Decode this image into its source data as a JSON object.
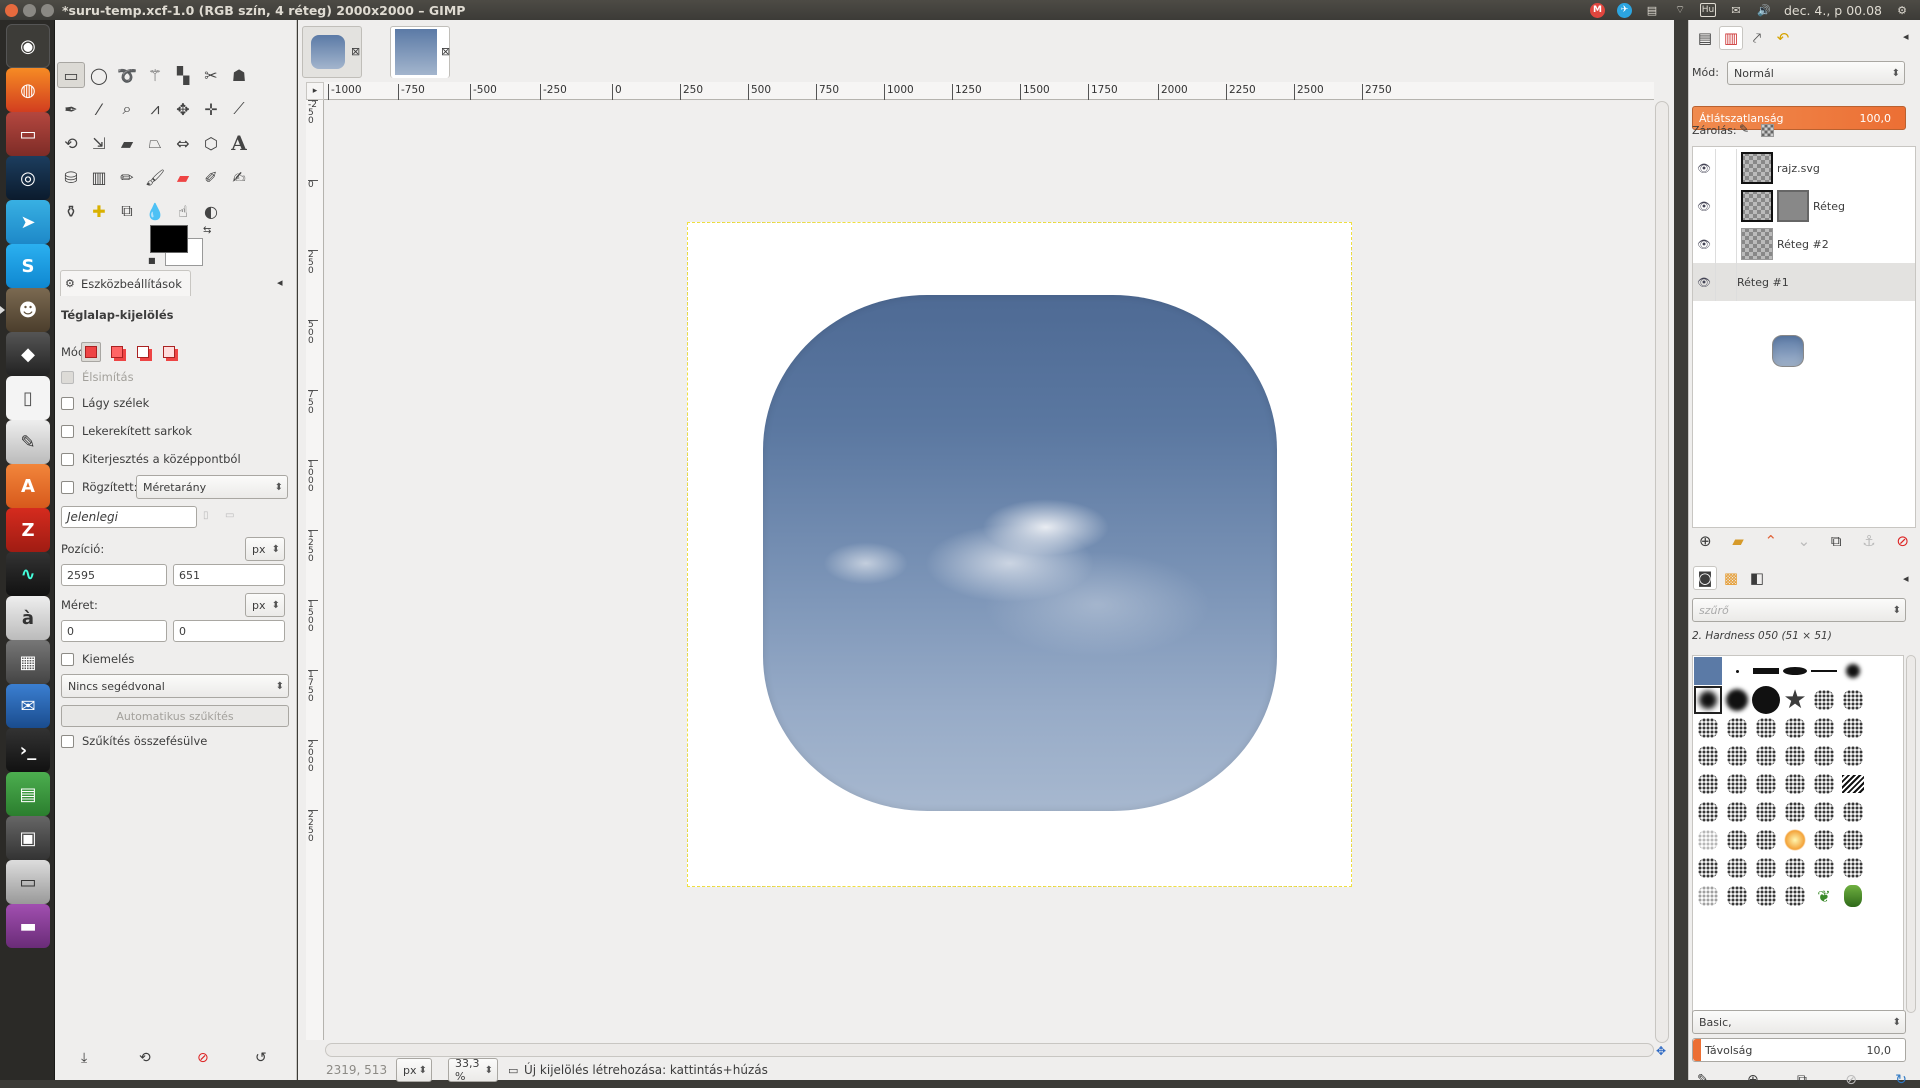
{
  "window": {
    "title": "*suru-temp.xcf-1.0 (RGB szín, 4 réteg) 2000x2000 – GIMP"
  },
  "panel": {
    "indicators": [
      "M",
      "✈",
      "▤",
      "⌔",
      "Hu",
      "✉",
      "🔊"
    ],
    "clock": "dec. 4., p 00.08"
  },
  "launcher": [
    "Dash",
    "Firefox",
    "Files",
    "Steam",
    "Telegram",
    "Skype",
    "GIMP",
    "Inkscape",
    "Document",
    "Text Editor",
    "Ubuntu Software",
    "FileZilla",
    "System Monitor",
    "Character Map",
    "Calculator",
    "Thunderbird",
    "Terminal",
    "Spreadsheet",
    "Workspace",
    "Drive",
    "Drive 2"
  ],
  "toolbox": {
    "options_tab": "Eszközbeállítások",
    "tool_name": "Téglalap-kijelölés",
    "mode_label": "Mód:",
    "antialias": "Élsimítás",
    "feather": "Lágy szélek",
    "rounded": "Lekerekített sarkok",
    "expand_center": "Kiterjesztés a középpontból",
    "fixed": "Rögzített:",
    "fixed_combo": "Méretarány",
    "current": "Jelenlegi",
    "position_label": "Pozíció:",
    "pos_unit": "px",
    "pos_x": "2595",
    "pos_y": "651",
    "size_label": "Méret:",
    "size_unit": "px",
    "size_w": "0",
    "size_h": "0",
    "highlight": "Kiemelés",
    "guides": "Nincs segédvonal",
    "auto_shrink": "Automatikus szűkítés",
    "shrink_merged": "Szűkítés összefésülve"
  },
  "ruler": {
    "h_ticks": [
      "-1000",
      "-750",
      "-500",
      "-250",
      "0",
      "250",
      "500",
      "750",
      "1000",
      "1250",
      "1500",
      "1750",
      "2000",
      "2250",
      "2500",
      "2750"
    ],
    "v_ticks": [
      "-250",
      "0",
      "250",
      "500",
      "750",
      "1000",
      "1250",
      "1500",
      "1750",
      "2000",
      "2250"
    ]
  },
  "status": {
    "coords": "2319, 513",
    "unit": "px",
    "zoom": "33,3 %",
    "message": "Új kijelölés létrehozása: kattintás+húzás"
  },
  "layers_panel": {
    "mode_label": "Mód:",
    "mode": "Normál",
    "opacity_label": "Átlátszatlanság",
    "opacity_value": "100,0",
    "lock_label": "Zárolás:",
    "layers": [
      {
        "name": "rajz.svg",
        "selected": false
      },
      {
        "name": "Réteg",
        "selected": false
      },
      {
        "name": "Réteg #2",
        "selected": false
      },
      {
        "name": "Réteg #1",
        "selected": true
      }
    ]
  },
  "brushes_panel": {
    "filter_placeholder": "szűrő",
    "brush_name": "2. Hardness 050 (51 × 51)",
    "preset": "Basic,",
    "spacing_label": "Távolság",
    "spacing_value": "10,0"
  },
  "colors": {
    "accent": "#ec6f34",
    "sky_top": "#4e6a94",
    "sky_bottom": "#a7b8cf"
  }
}
